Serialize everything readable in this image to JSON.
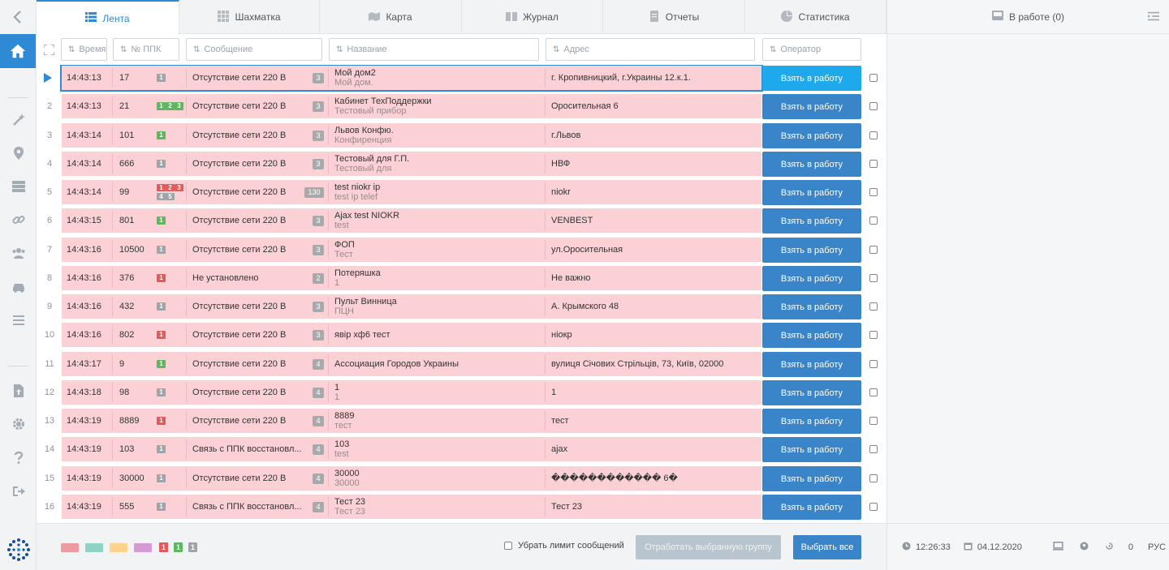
{
  "tabs": [
    {
      "label": "Лента",
      "icon": "list-icon",
      "active": true
    },
    {
      "label": "Шахматка",
      "icon": "grid-icon",
      "active": false
    },
    {
      "label": "Карта",
      "icon": "map-icon",
      "active": false
    },
    {
      "label": "Журнал",
      "icon": "book-icon",
      "active": false
    },
    {
      "label": "Отчеты",
      "icon": "report-icon",
      "active": false
    },
    {
      "label": "Статистика",
      "icon": "pie-chart-icon",
      "active": false
    }
  ],
  "right_panel": {
    "title": "В работе (0)",
    "time": "12:26:33",
    "date": "04.12.2020",
    "counter": "0",
    "lang": "РУС"
  },
  "filters": {
    "time": "Время",
    "ppk": "№ ППК",
    "message": "Сообщение",
    "name": "Название",
    "address": "Адрес",
    "operator": "Оператор"
  },
  "colors": {
    "accent": "#2f8ad6",
    "row_bg": "#fbd1d6",
    "button": "#3a84c9",
    "button_selected": "#1ea9ec",
    "level_gray": "#9ea4a8",
    "level_red": "#e25a5a",
    "level_green": "#5bb85b"
  },
  "action_label": "Взять в работу",
  "rows": [
    {
      "num": "",
      "time": "14:43:13",
      "ppk": "17",
      "levels": [
        {
          "v": "1",
          "c": "gray"
        }
      ],
      "message": "Отсутствие сети 220 В",
      "count": "3",
      "name": "Мой дом2",
      "sub": "Мой дом.",
      "address": "г. Кропивницкий, г.Украины 12.к.1.",
      "selected": true
    },
    {
      "num": "2",
      "time": "14:43:13",
      "ppk": "21",
      "levels": [
        {
          "v": "1",
          "c": "green"
        },
        {
          "v": "2",
          "c": "green"
        },
        {
          "v": "3",
          "c": "green"
        }
      ],
      "message": "Отсутствие сети 220 В",
      "count": "3",
      "name": "Кабинет ТехПоддержки",
      "sub": "Тестовый прибор",
      "address": "Оросительная 6"
    },
    {
      "num": "3",
      "time": "14:43:14",
      "ppk": "101",
      "levels": [
        {
          "v": "1",
          "c": "green"
        }
      ],
      "message": "Отсутствие сети 220 В",
      "count": "3",
      "name": "Львов Конфю.",
      "sub": "Конфиренция",
      "address": "г.Львов"
    },
    {
      "num": "4",
      "time": "14:43:14",
      "ppk": "666",
      "levels": [
        {
          "v": "1",
          "c": "gray"
        }
      ],
      "message": "Отсутствие сети 220 В",
      "count": "3",
      "name": "Тестовый для                     Г.П.",
      "sub": "Тестовый для",
      "address": "НВФ"
    },
    {
      "num": "5",
      "time": "14:43:14",
      "ppk": "99",
      "levels": [
        {
          "v": "1",
          "c": "red"
        },
        {
          "v": "2",
          "c": "red"
        },
        {
          "v": "3",
          "c": "red"
        },
        {
          "v": "4",
          "c": "gray"
        },
        {
          "v": "5",
          "c": "gray"
        }
      ],
      "message": "Отсутствие сети 220 В",
      "count": "130",
      "name": "test niokr ip",
      "sub": "test ip telef",
      "address": "niokr"
    },
    {
      "num": "6",
      "time": "14:43:15",
      "ppk": "801",
      "levels": [
        {
          "v": "1",
          "c": "green"
        }
      ],
      "message": "Отсутствие сети 220 В",
      "count": "3",
      "name": "Ajax test NIOKR",
      "sub": "test",
      "address": "VENBEST"
    },
    {
      "num": "7",
      "time": "14:43:16",
      "ppk": "10500",
      "levels": [
        {
          "v": "1",
          "c": "gray"
        }
      ],
      "message": "Отсутствие сети 220 В",
      "count": "3",
      "name": "ФОП",
      "sub": "Тест",
      "address": "ул.Оросительная"
    },
    {
      "num": "8",
      "time": "14:43:16",
      "ppk": "376",
      "levels": [
        {
          "v": "1",
          "c": "red"
        }
      ],
      "message": "Не установлено",
      "count": "2",
      "name": "Потеряшка",
      "sub": "1",
      "address": "Не важно"
    },
    {
      "num": "9",
      "time": "14:43:16",
      "ppk": "432",
      "levels": [
        {
          "v": "1",
          "c": "gray"
        }
      ],
      "message": "Отсутствие сети 220 В",
      "count": "3",
      "name": "Пульт Винница",
      "sub": "ПЦН",
      "address": "А. Крымского 48"
    },
    {
      "num": "10",
      "time": "14:43:16",
      "ppk": "802",
      "levels": [
        {
          "v": "1",
          "c": "red"
        }
      ],
      "message": "Отсутствие сети 220 В",
      "count": "3",
      "name": "явір хф6 тест",
      "sub": "",
      "address": "ніокр"
    },
    {
      "num": "11",
      "time": "14:43:17",
      "ppk": "9",
      "levels": [
        {
          "v": "1",
          "c": "green"
        }
      ],
      "message": "Отсутствие сети 220 В",
      "count": "4",
      "name": "Ассоциация Городов Украины",
      "sub": "",
      "address": "вулиця Січових Стрільців, 73, Київ, 02000"
    },
    {
      "num": "12",
      "time": "14:43:18",
      "ppk": "98",
      "levels": [
        {
          "v": "1",
          "c": "gray"
        }
      ],
      "message": "Отсутствие сети 220 В",
      "count": "4",
      "name": "1",
      "sub": "1",
      "address": "1"
    },
    {
      "num": "13",
      "time": "14:43:19",
      "ppk": "8889",
      "levels": [
        {
          "v": "1",
          "c": "red"
        }
      ],
      "message": "Отсутствие сети 220 В",
      "count": "4",
      "name": "8889",
      "sub": "тест",
      "address": "                  тест"
    },
    {
      "num": "14",
      "time": "14:43:19",
      "ppk": "103",
      "levels": [
        {
          "v": "1",
          "c": "gray"
        }
      ],
      "message": "Связь с ППК восстановл...",
      "count": "4",
      "name": "103",
      "sub": "test",
      "address": "ajax"
    },
    {
      "num": "15",
      "time": "14:43:19",
      "ppk": "30000",
      "levels": [
        {
          "v": "1",
          "c": "gray"
        }
      ],
      "message": "Отсутствие сети 220 В",
      "count": "4",
      "name": "30000",
      "sub": "30000",
      "address": "������������ 6�"
    },
    {
      "num": "16",
      "time": "14:43:19",
      "ppk": "555",
      "levels": [
        {
          "v": "1",
          "c": "gray"
        }
      ],
      "message": "Связь с ППК восстановл...",
      "count": "4",
      "name": "Тест 23",
      "sub": "Тест 23",
      "address": "Тест 23"
    }
  ],
  "legend": {
    "swatches": [
      "#ee9b9f",
      "#8fd3c5",
      "#fdd48a",
      "#d59ad6"
    ],
    "levels": [
      {
        "v": "1",
        "c": "#e25a5a"
      },
      {
        "v": "1",
        "c": "#5bb85b"
      },
      {
        "v": "1",
        "c": "#9ea4a8"
      }
    ]
  },
  "bottom": {
    "limit_label": "Убрать лимит сообщений",
    "process_group": "Отработать выбранную группу",
    "select_all": "Выбрать все"
  }
}
